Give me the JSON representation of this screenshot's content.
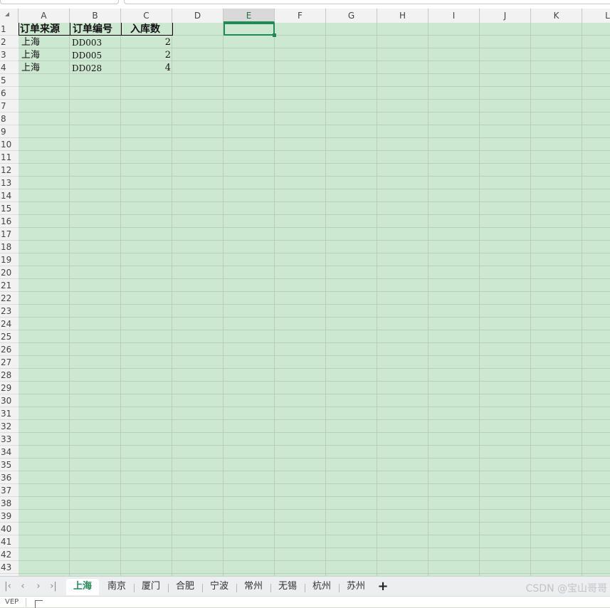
{
  "columns": [
    "A",
    "B",
    "C",
    "D",
    "E",
    "F",
    "G",
    "H",
    "I",
    "J",
    "K",
    "L"
  ],
  "active_column": "E",
  "rows": [
    "1",
    "2",
    "3",
    "4",
    "5",
    "6",
    "7",
    "8",
    "9",
    "10",
    "11",
    "12",
    "13",
    "14",
    "15",
    "16",
    "17",
    "18",
    "19",
    "20",
    "21",
    "22",
    "23",
    "24",
    "25",
    "26",
    "27",
    "28",
    "29",
    "30",
    "31",
    "32",
    "33",
    "34",
    "35",
    "36",
    "37",
    "38",
    "39",
    "40",
    "41",
    "42",
    "43"
  ],
  "table": {
    "headers": [
      "订单来源",
      "订单编号",
      "入库数"
    ],
    "rows": [
      [
        "上海",
        "DD003",
        "2"
      ],
      [
        "上海",
        "DD005",
        "2"
      ],
      [
        "上海",
        "DD028",
        "4"
      ]
    ]
  },
  "selected_cell": "E1",
  "sheet_tabs": [
    "上海",
    "南京",
    "厦门",
    "合肥",
    "宁波",
    "常州",
    "无锡",
    "杭州",
    "苏州"
  ],
  "active_sheet": "上海",
  "nav_icons": [
    "first-sheet-icon",
    "prev-sheet-icon",
    "next-sheet-icon",
    "last-sheet-icon"
  ],
  "add_sheet_label": "+",
  "watermark": "CSDN @宝山哥哥",
  "status": {
    "left_text": "VEP"
  },
  "colors": {
    "grid_bg": "#cde8d0",
    "accent": "#1e8a55"
  }
}
